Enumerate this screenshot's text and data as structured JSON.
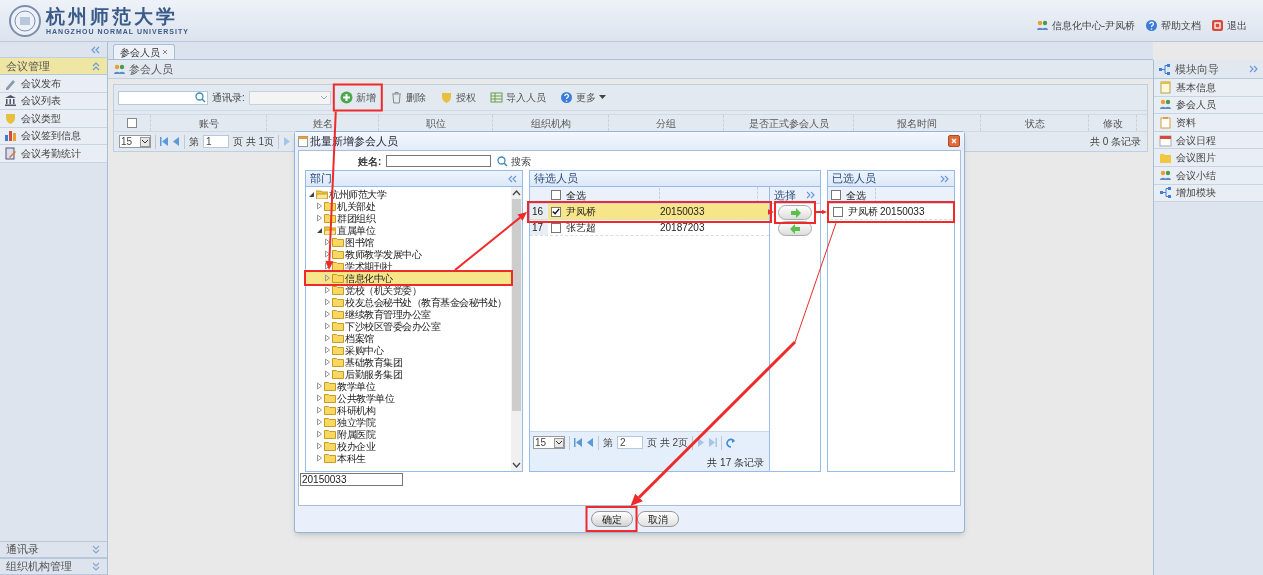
{
  "header": {
    "logo_title": "杭州师范大学",
    "logo_subtitle": "HANGZHOU NORMAL UNIVERSITY",
    "links": [
      {
        "kind": "user",
        "label": "信息化中心-尹凤桥"
      },
      {
        "kind": "help",
        "label": "帮助文档"
      },
      {
        "kind": "exit",
        "label": "退出"
      }
    ]
  },
  "left_sidebar": {
    "sections": [
      {
        "title": "会议管理",
        "expanded": true,
        "items": [
          {
            "kind": "pen",
            "label": "会议发布"
          },
          {
            "kind": "building",
            "label": "会议列表"
          },
          {
            "kind": "shield",
            "label": "会议类型"
          },
          {
            "kind": "chart",
            "label": "会议签到信息"
          },
          {
            "kind": "form",
            "label": "会议考勤统计"
          }
        ]
      },
      {
        "title": "通讯录",
        "expanded": false
      },
      {
        "title": "组织机构管理",
        "expanded": false
      }
    ]
  },
  "tabs": [
    {
      "label": "参会人员",
      "selected": true
    }
  ],
  "panel": {
    "title": "参会人员"
  },
  "toolbar": {
    "filter_label": "通讯录:",
    "buttons": [
      {
        "kind": "add",
        "label": "新增"
      },
      {
        "kind": "delete",
        "label": "删除"
      },
      {
        "kind": "grant",
        "label": "授权"
      },
      {
        "kind": "import",
        "label": "导入人员"
      },
      {
        "kind": "more",
        "label": "更多"
      }
    ]
  },
  "grid": {
    "header_checked": false,
    "columns": [
      "账号",
      "姓名",
      "职位",
      "组织机构",
      "分组",
      "是否正式参会人员",
      "报名时间",
      "状态",
      "修改"
    ],
    "pager": {
      "page_size": "15",
      "page_prefix": "第",
      "page": "1",
      "page_suffix": "页 共 1页",
      "total": "共 0 条记录"
    }
  },
  "right_sidebar": {
    "title": "模块向导",
    "items": [
      {
        "kind": "note",
        "label": "基本信息"
      },
      {
        "kind": "people",
        "label": "参会人员"
      },
      {
        "kind": "clipboard",
        "label": "资料"
      },
      {
        "kind": "calendar",
        "label": "会议日程"
      },
      {
        "kind": "folder",
        "label": "会议图片"
      },
      {
        "kind": "people",
        "label": "会议小结"
      },
      {
        "kind": "nodes",
        "label": "增加模块"
      }
    ]
  },
  "dialog": {
    "title": "批量新增参会人员",
    "name_label": "姓名:",
    "search_label": "搜索",
    "tree": {
      "title": "部门",
      "nodes": [
        {
          "label": "杭州师范大学",
          "expanded": true,
          "selected": false,
          "children": [
            {
              "label": "机关部处",
              "expanded": false,
              "selected": false
            },
            {
              "label": "群团组织",
              "expanded": false,
              "selected": false
            },
            {
              "label": "直属单位",
              "expanded": true,
              "selected": false,
              "children": [
                {
                  "label": "图书馆",
                  "expanded": false,
                  "selected": false
                },
                {
                  "label": "教师教学发展中心",
                  "expanded": false,
                  "selected": false
                },
                {
                  "label": "学术期刊社",
                  "expanded": false,
                  "selected": false
                },
                {
                  "label": "信息化中心",
                  "expanded": false,
                  "selected": true
                },
                {
                  "label": "党校（机关党委）",
                  "expanded": false,
                  "selected": false
                },
                {
                  "label": "校友总会秘书处（教育基金会秘书处）",
                  "expanded": false,
                  "selected": false
                },
                {
                  "label": "继续教育管理办公室",
                  "expanded": false,
                  "selected": false
                },
                {
                  "label": "下沙校区管委会办公室",
                  "expanded": false,
                  "selected": false
                },
                {
                  "label": "档案馆",
                  "expanded": false,
                  "selected": false
                },
                {
                  "label": "采购中心",
                  "expanded": false,
                  "selected": false
                },
                {
                  "label": "基础教育集团",
                  "expanded": false,
                  "selected": false
                },
                {
                  "label": "后勤服务集团",
                  "expanded": false,
                  "selected": false
                }
              ]
            },
            {
              "label": "教学单位",
              "expanded": false,
              "selected": false
            },
            {
              "label": "公共教学单位",
              "expanded": false,
              "selected": false
            },
            {
              "label": "科研机构",
              "expanded": false,
              "selected": false
            },
            {
              "label": "独立学院",
              "expanded": false,
              "selected": false
            },
            {
              "label": "附属医院",
              "expanded": false,
              "selected": false
            },
            {
              "label": "校办企业",
              "expanded": false,
              "selected": false
            },
            {
              "label": "本科生",
              "expanded": false,
              "selected": false
            }
          ]
        }
      ]
    },
    "candidates": {
      "title": "待选人员",
      "select_all": "全选",
      "header_checked": false,
      "rows": [
        {
          "index": "16",
          "checked": true,
          "selected": true,
          "name": "尹凤桥",
          "account": "20150033"
        },
        {
          "index": "17",
          "checked": false,
          "selected": false,
          "name": "张艺超",
          "account": "20187203"
        }
      ],
      "pager": {
        "page_size": "15",
        "page_prefix": "第",
        "page": "2",
        "page_suffix": "页 共 2页",
        "total": "共 17 条记录"
      }
    },
    "transfer": {
      "title": "选择"
    },
    "chosen": {
      "title": "已选人员",
      "select_all": "全选",
      "header_checked": false,
      "rows": [
        {
          "checked": false,
          "name": "尹凤桥",
          "account": "20150033"
        }
      ]
    },
    "code_value": "20150033",
    "buttons": [
      {
        "kind": "primary",
        "label": "确定"
      },
      {
        "kind": "secondary",
        "label": "取消"
      }
    ]
  }
}
